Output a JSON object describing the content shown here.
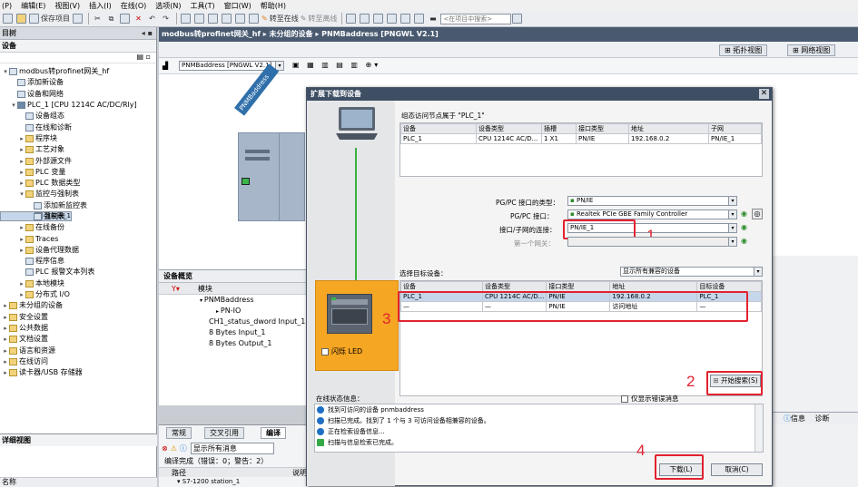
{
  "menu": {
    "items": [
      "(P)",
      "编辑(E)",
      "视图(V)",
      "插入(I)",
      "在线(O)",
      "选项(N)",
      "工具(T)",
      "窗口(W)",
      "帮助(H)"
    ]
  },
  "toolbar": {
    "save_project": "保存项目",
    "go_online": "转至在线",
    "go_offline": "转至离线",
    "search_placeholder": "<在项目中搜索>"
  },
  "left": {
    "panel_title": "目树",
    "section_title": "设备",
    "tree": [
      {
        "label": "modbus转profinet网关_hf",
        "indent": 0,
        "arrow": "▾",
        "icon": "project"
      },
      {
        "label": "添加新设备",
        "indent": 1,
        "arrow": "",
        "icon": "add"
      },
      {
        "label": "设备和网络",
        "indent": 1,
        "arrow": "",
        "icon": "net"
      },
      {
        "label": "PLC_1 [CPU 1214C AC/DC/Rly]",
        "indent": 1,
        "arrow": "▾",
        "icon": "plc"
      },
      {
        "label": "设备组态",
        "indent": 2,
        "arrow": "",
        "icon": "dev"
      },
      {
        "label": "在线和诊断",
        "indent": 2,
        "arrow": "",
        "icon": "diag"
      },
      {
        "label": "程序块",
        "indent": 2,
        "arrow": "▸",
        "icon": "folder"
      },
      {
        "label": "工艺对象",
        "indent": 2,
        "arrow": "▸",
        "icon": "folder"
      },
      {
        "label": "外部源文件",
        "indent": 2,
        "arrow": "▸",
        "icon": "folder"
      },
      {
        "label": "PLC 变量",
        "indent": 2,
        "arrow": "▸",
        "icon": "folder"
      },
      {
        "label": "PLC 数据类型",
        "indent": 2,
        "arrow": "▸",
        "icon": "folder"
      },
      {
        "label": "监控与强制表",
        "indent": 2,
        "arrow": "▾",
        "icon": "folder"
      },
      {
        "label": "添加新监控表",
        "indent": 3,
        "arrow": "",
        "icon": "add"
      },
      {
        "label": "监控表_1",
        "indent": 3,
        "arrow": "",
        "icon": "table",
        "selected": true
      },
      {
        "label": "强制表",
        "indent": 3,
        "arrow": "",
        "icon": "table"
      },
      {
        "label": "在线备份",
        "indent": 2,
        "arrow": "▸",
        "icon": "folder"
      },
      {
        "label": "Traces",
        "indent": 2,
        "arrow": "▸",
        "icon": "folder"
      },
      {
        "label": "设备代理数据",
        "indent": 2,
        "arrow": "▸",
        "icon": "folder"
      },
      {
        "label": "程序信息",
        "indent": 2,
        "arrow": "",
        "icon": "dev"
      },
      {
        "label": "PLC 报警文本列表",
        "indent": 2,
        "arrow": "",
        "icon": "dev"
      },
      {
        "label": "本地模块",
        "indent": 2,
        "arrow": "▸",
        "icon": "folder"
      },
      {
        "label": "分布式 I/O",
        "indent": 2,
        "arrow": "▸",
        "icon": "folder"
      },
      {
        "label": "未分组的设备",
        "indent": 0,
        "arrow": "▸",
        "icon": "folder"
      },
      {
        "label": "安全设置",
        "indent": 0,
        "arrow": "▸",
        "icon": "folder"
      },
      {
        "label": "公共数据",
        "indent": 0,
        "arrow": "▸",
        "icon": "folder"
      },
      {
        "label": "文档设置",
        "indent": 0,
        "arrow": "▸",
        "icon": "folder"
      },
      {
        "label": "语言和资源",
        "indent": 0,
        "arrow": "▸",
        "icon": "folder"
      },
      {
        "label": "在线访问",
        "indent": 0,
        "arrow": "▸",
        "icon": "folder"
      },
      {
        "label": "读卡器/USB 存储器",
        "indent": 0,
        "arrow": "▸",
        "icon": "folder"
      }
    ],
    "detail_title": "详细视图",
    "name_col": "名称"
  },
  "editor": {
    "breadcrumb": "modbus转profinet网关_hf  ▸  未分组的设备  ▸  PNMBaddress [PNGWL V2.1]",
    "topology_view": "拓扑视图",
    "network_view": "网络视图",
    "device_select": "PNMBaddress [PNGWL V2.1]",
    "device_label": "PNMBaddress",
    "overview_tab": "设备概览",
    "module_col": "模块",
    "overview_rows": [
      "PNMBaddress",
      "PN-IO",
      "CH1_status_dword Input_1",
      "8 Bytes Input_1",
      "8 Bytes Output_1"
    ],
    "zoom_pct": "%"
  },
  "properties": {
    "tabs": [
      "常规",
      "交叉引用",
      "编译"
    ],
    "filter": "显示所有消息",
    "compile_result": "编译完成（错误：0；警告：2）",
    "path_col": "路径",
    "desc_col": "说明",
    "row": "S7-1200 station_1"
  },
  "right": {
    "info": "信息",
    "diag": "诊断"
  },
  "dialog": {
    "title": "扩展下载到设备",
    "configured_title": "组态访问节点属于 \"PLC_1\"",
    "cfg_headers": [
      "设备",
      "设备类型",
      "插槽",
      "接口类型",
      "地址",
      "子网"
    ],
    "cfg_row": [
      "PLC_1",
      "CPU 1214C AC/D...",
      "1 X1",
      "PN/IE",
      "192.168.0.2",
      "PN/IE_1"
    ],
    "pgpc_type_label": "PG/PC 接口的类型：",
    "pgpc_type_value": "PN/IE",
    "pgpc_if_label": "PG/PC 接口：",
    "pgpc_if_value": "Realtek PCIe GBE Family Controller",
    "subnet_label": "接口/子网的连接：",
    "subnet_value": "PN/IE_1",
    "gateway_label": "第一个网关：",
    "target_label": "选择目标设备：",
    "target_filter": "显示所有兼容的设备",
    "tgt_headers": [
      "设备",
      "设备类型",
      "接口类型",
      "地址",
      "目标设备"
    ],
    "tgt_rows": [
      [
        "PLC_1",
        "CPU 1214C AC/D...",
        "PN/IE",
        "192.168.0.2",
        "PLC_1"
      ],
      [
        "—",
        "—",
        "PN/IE",
        "访问地址",
        "—"
      ]
    ],
    "flash_led": "闪烁 LED",
    "start_search": "开始搜索(S)",
    "status_label": "在线状态信息：",
    "errors_only": "仅显示错误消息",
    "status_lines": [
      "找到可访问的设备 pnmbaddress",
      "扫描已完成。找到了 1 个与 3 可访问设备相兼容的设备。",
      "正在检索设备信息...",
      "扫描与信息检索已完成。"
    ],
    "download": "下载(L)",
    "cancel": "取消(C)"
  },
  "annotations": {
    "n1": "1",
    "n2": "2",
    "n3": "3",
    "n4": "4"
  }
}
